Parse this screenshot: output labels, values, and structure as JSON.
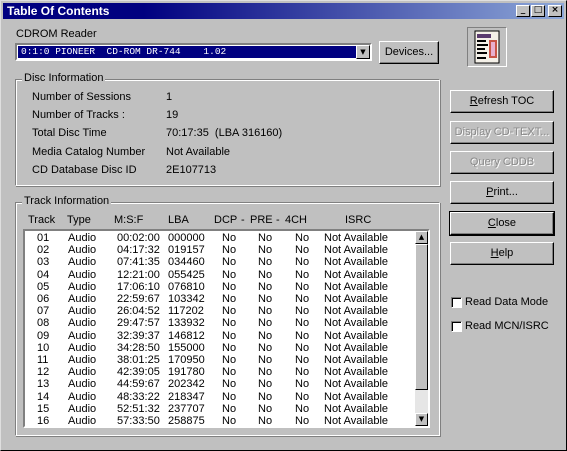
{
  "window": {
    "title": "Table Of Contents",
    "minimize_glyph": "_",
    "maximize_glyph": "□",
    "close_glyph": "×"
  },
  "cdrom": {
    "label": "CDROM Reader",
    "selected": "0:1:0 PIONEER  CD-ROM DR-744    1.02",
    "devices_button": "Devices..."
  },
  "disc_info": {
    "title": "Disc Information",
    "rows": [
      {
        "label": "Number of Sessions",
        "value": "1"
      },
      {
        "label": "Number of Tracks :",
        "value": "19"
      },
      {
        "label": "Total Disc Time",
        "value": "70:17:35  (LBA 316160)"
      },
      {
        "label": "Media Catalog Number",
        "value": "Not Available"
      },
      {
        "label": "CD Database Disc ID",
        "value": "2E107713"
      }
    ]
  },
  "track_info": {
    "title": "Track Information",
    "columns": [
      "Track",
      "Type",
      "M:S:F",
      "LBA",
      "DCP",
      "-",
      "PRE",
      "-",
      "4CH",
      "ISRC"
    ],
    "rows": [
      [
        "01",
        "Audio",
        "00:02:00",
        "000000",
        "No",
        "No",
        "No",
        "Not Available"
      ],
      [
        "02",
        "Audio",
        "04:17:32",
        "019157",
        "No",
        "No",
        "No",
        "Not Available"
      ],
      [
        "03",
        "Audio",
        "07:41:35",
        "034460",
        "No",
        "No",
        "No",
        "Not Available"
      ],
      [
        "04",
        "Audio",
        "12:21:00",
        "055425",
        "No",
        "No",
        "No",
        "Not Available"
      ],
      [
        "05",
        "Audio",
        "17:06:10",
        "076810",
        "No",
        "No",
        "No",
        "Not Available"
      ],
      [
        "06",
        "Audio",
        "22:59:67",
        "103342",
        "No",
        "No",
        "No",
        "Not Available"
      ],
      [
        "07",
        "Audio",
        "26:04:52",
        "117202",
        "No",
        "No",
        "No",
        "Not Available"
      ],
      [
        "08",
        "Audio",
        "29:47:57",
        "133932",
        "No",
        "No",
        "No",
        "Not Available"
      ],
      [
        "09",
        "Audio",
        "32:39:37",
        "146812",
        "No",
        "No",
        "No",
        "Not Available"
      ],
      [
        "10",
        "Audio",
        "34:28:50",
        "155000",
        "No",
        "No",
        "No",
        "Not Available"
      ],
      [
        "11",
        "Audio",
        "38:01:25",
        "170950",
        "No",
        "No",
        "No",
        "Not Available"
      ],
      [
        "12",
        "Audio",
        "42:39:05",
        "191780",
        "No",
        "No",
        "No",
        "Not Available"
      ],
      [
        "13",
        "Audio",
        "44:59:67",
        "202342",
        "No",
        "No",
        "No",
        "Not Available"
      ],
      [
        "14",
        "Audio",
        "48:33:22",
        "218347",
        "No",
        "No",
        "No",
        "Not Available"
      ],
      [
        "15",
        "Audio",
        "52:51:32",
        "237707",
        "No",
        "No",
        "No",
        "Not Available"
      ],
      [
        "16",
        "Audio",
        "57:33:50",
        "258875",
        "No",
        "No",
        "No",
        "Not Available"
      ]
    ]
  },
  "buttons": {
    "refresh": "Refresh TOC",
    "display_cdtext": "Display CD-TEXT...",
    "query_cddb": "Query CDDB",
    "print": "Print...",
    "close": "Close",
    "help": "Help"
  },
  "options": {
    "read_data_mode": "Read Data Mode",
    "read_mcn_isrc": "Read MCN/ISRC"
  },
  "icons": {
    "app": "disc-document-icon",
    "combo_arrow": "▼",
    "scroll_up": "▲",
    "scroll_down": "▼"
  }
}
